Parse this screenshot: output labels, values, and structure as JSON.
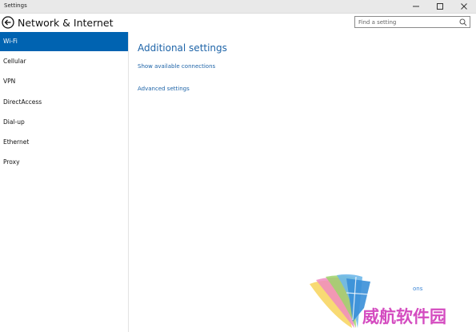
{
  "window": {
    "title": "Settings"
  },
  "header": {
    "page_title": "Network & Internet"
  },
  "search": {
    "placeholder": "Find a setting"
  },
  "sidebar": {
    "items": [
      {
        "label": "Wi-Fi",
        "selected": true
      },
      {
        "label": "Cellular",
        "selected": false
      },
      {
        "label": "VPN",
        "selected": false
      },
      {
        "label": "DirectAccess",
        "selected": false
      },
      {
        "label": "Dial-up",
        "selected": false
      },
      {
        "label": "Ethernet",
        "selected": false
      },
      {
        "label": "Proxy",
        "selected": false
      }
    ]
  },
  "main": {
    "heading": "Additional settings",
    "links": [
      {
        "label": "Show available connections"
      },
      {
        "label": "Advanced settings"
      }
    ]
  },
  "watermark": {
    "text": "威航软件园",
    "fragment": "ons"
  },
  "colors": {
    "accent": "#0063b1",
    "link": "#1e64a8",
    "watermark_text": "#d44cc0"
  },
  "icons": {
    "back": "back-arrow-icon",
    "search": "search-icon",
    "minimize": "minimize-icon",
    "maximize": "maximize-icon",
    "close": "close-icon"
  }
}
